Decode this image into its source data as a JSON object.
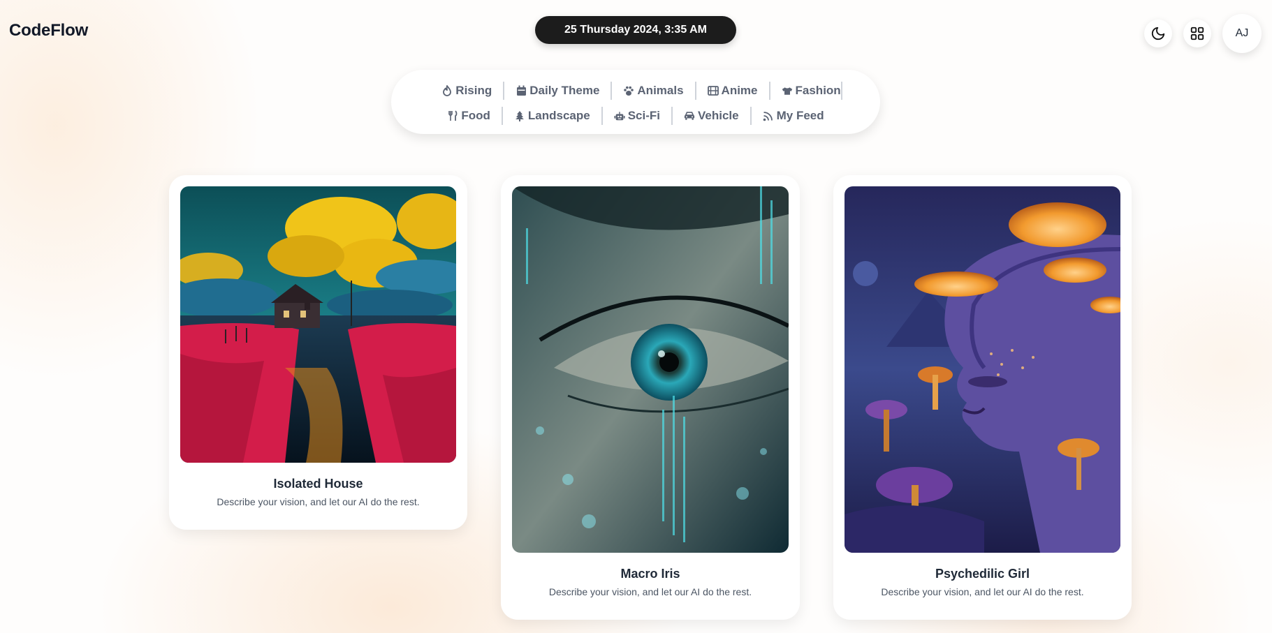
{
  "header": {
    "logo": "CodeFlow",
    "datetime": "25 Thursday 2024, 3:35 AM",
    "theme_icon": "moon-icon",
    "apps_icon": "grid-icon",
    "avatar_initials": "AJ"
  },
  "categories": {
    "row1": [
      {
        "label": "Rising",
        "icon": "fire-icon"
      },
      {
        "label": "Daily Theme",
        "icon": "calendar-icon"
      },
      {
        "label": "Animals",
        "icon": "paw-icon"
      },
      {
        "label": "Anime",
        "icon": "film-icon"
      },
      {
        "label": "Fashion",
        "icon": "shirt-icon"
      }
    ],
    "row2": [
      {
        "label": "Food",
        "icon": "utensils-icon"
      },
      {
        "label": "Landscape",
        "icon": "tree-icon"
      },
      {
        "label": "Sci-Fi",
        "icon": "robot-icon"
      },
      {
        "label": "Vehicle",
        "icon": "car-icon"
      },
      {
        "label": "My Feed",
        "icon": "rss-icon"
      }
    ]
  },
  "cards": [
    {
      "title": "Isolated House",
      "description": "Describe your vision, and let our AI do the rest."
    },
    {
      "title": "Macro Iris",
      "description": "Describe your vision, and let our AI do the rest."
    },
    {
      "title": "Psychedilic Girl",
      "description": "Describe your vision, and let our AI do the rest."
    }
  ],
  "colors": {
    "accent_dark": "#1c1c1c",
    "nav_text": "#5b6373",
    "title_text": "#1f2937"
  }
}
